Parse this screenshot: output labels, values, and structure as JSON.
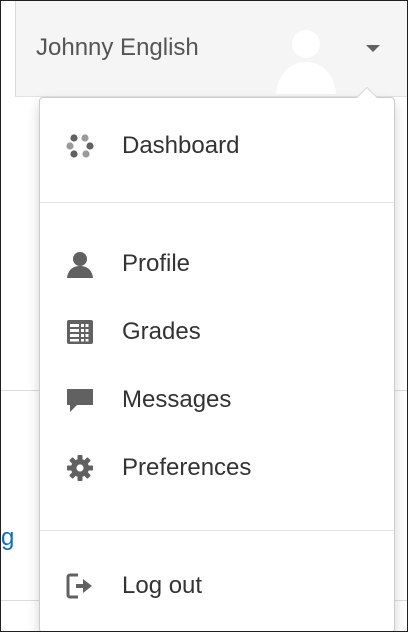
{
  "user": {
    "name": "Johnny English"
  },
  "background": {
    "link_fragment": "g"
  },
  "menu": {
    "items": [
      {
        "label": "Dashboard",
        "icon": "dashboard-icon"
      },
      {
        "label": "Profile",
        "icon": "user-icon"
      },
      {
        "label": "Grades",
        "icon": "grades-table-icon"
      },
      {
        "label": "Messages",
        "icon": "speech-bubble-icon"
      },
      {
        "label": "Preferences",
        "icon": "cog-icon"
      },
      {
        "label": "Log out",
        "icon": "sign-out-icon"
      }
    ]
  },
  "colors": {
    "icon": "#616161",
    "text": "#333333",
    "link": "#0f6cbf",
    "topbar_bg": "#f5f5f5"
  }
}
